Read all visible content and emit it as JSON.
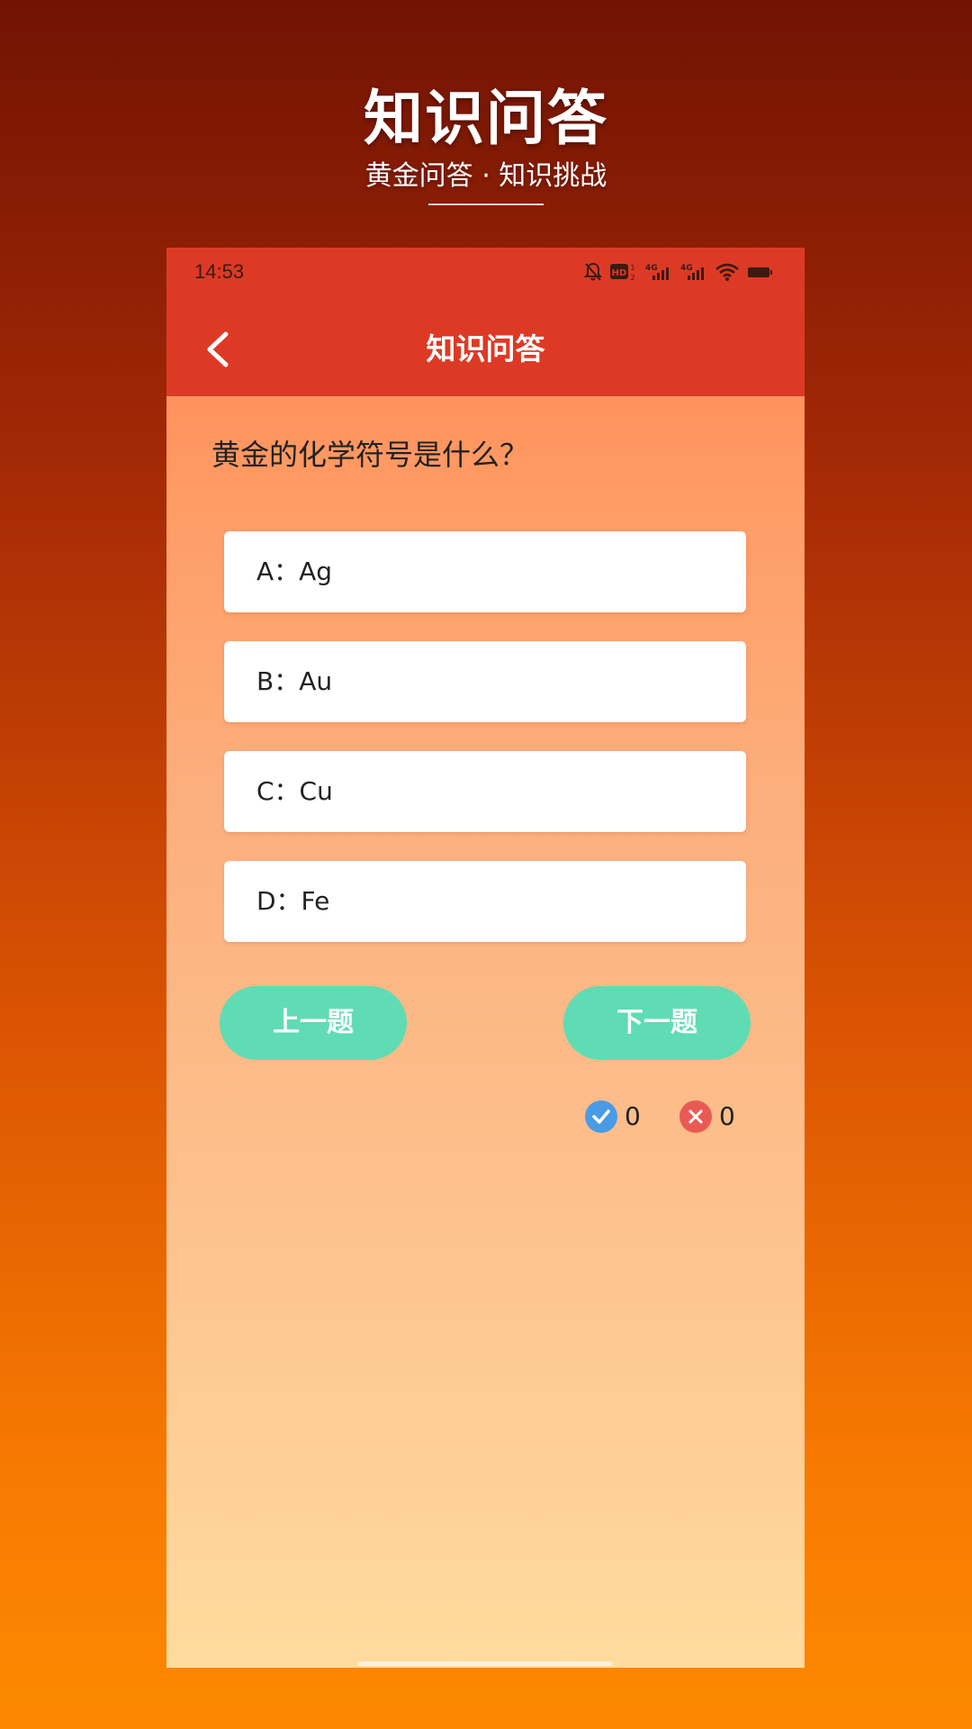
{
  "promo": {
    "title": "知识问答",
    "subtitle": "黄金问答 · 知识挑战"
  },
  "status_bar": {
    "time": "14:53",
    "icons": [
      "bell-off-icon",
      "hd-icon",
      "signal-4g-icon",
      "signal-4g-icon",
      "wifi-icon",
      "battery-icon"
    ]
  },
  "app_bar": {
    "title": "知识问答",
    "back_icon": "chevron-left-icon"
  },
  "quiz": {
    "question": "黄金的化学符号是什么？",
    "options": [
      {
        "label": "A：Ag"
      },
      {
        "label": "B：Au"
      },
      {
        "label": "C：Cu"
      },
      {
        "label": "D：Fe"
      }
    ],
    "prev_label": "上一题",
    "next_label": "下一题"
  },
  "score": {
    "correct": "0",
    "wrong": "0"
  },
  "colors": {
    "app_bar": "#dd3a25",
    "button": "#5fdcb4",
    "correct": "#4a9be6",
    "wrong": "#ea5a55"
  }
}
